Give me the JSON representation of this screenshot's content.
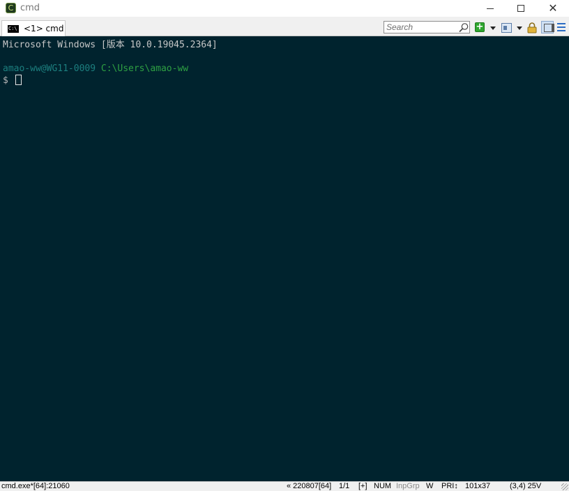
{
  "window": {
    "title": "cmd",
    "app_icon_glyph": "C",
    "buttons": {
      "minimize": "minimize-icon",
      "maximize": "maximize-icon",
      "close": "close-icon"
    }
  },
  "toolbar": {
    "tab_label": "<1> cmd",
    "tab_icon_text": "C:\\",
    "search_placeholder": "Search",
    "new_console_glyph": "+",
    "icons": [
      "search-icon",
      "new-console-icon",
      "layout-icon",
      "lock-icon",
      "panel-icon",
      "menu-icon"
    ]
  },
  "terminal": {
    "line1": "Microsoft Windows [版本 10.0.19045.2364]",
    "user_host": "amao-ww@WG11-0009",
    "cwd": "C:\\Users\\amao-ww",
    "prompt": "$",
    "colors": {
      "background": "#00232e",
      "text": "#c8c8c8",
      "user_host": "#1c7f7f",
      "cwd": "#2ea043"
    }
  },
  "statusbar": {
    "process": "cmd.exe*[64]:21060",
    "session": "« 220807[64]",
    "console_index": "1/1",
    "plus": "[+]",
    "num": "NUM",
    "inpgrp": "InpGrp",
    "w": "W",
    "pri": "PRI↕",
    "size": "101x37",
    "cursor_pos": "(3,4) 25V"
  }
}
